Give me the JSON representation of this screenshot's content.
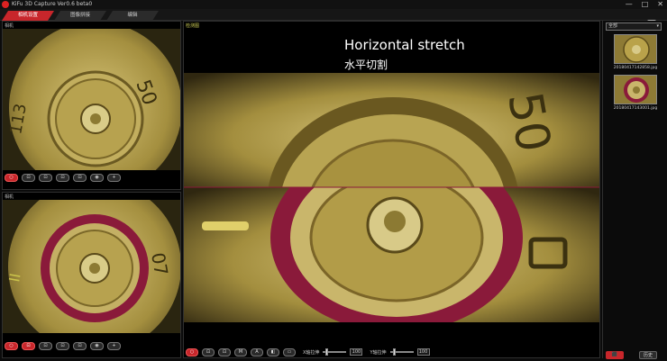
{
  "app": {
    "title": "KiFu 3D Capture Ver0.6 beta0",
    "window_buttons": [
      "—",
      "□",
      "✕"
    ]
  },
  "tabs": [
    {
      "label": "相机设置",
      "active": true
    },
    {
      "label": "图像拼接",
      "active": false
    },
    {
      "label": "编辑",
      "active": false
    }
  ],
  "left_top": {
    "label": "相机",
    "toolbar": [
      "○",
      "⊡",
      "⊡",
      "⊡",
      "⊡",
      "◉",
      "+"
    ]
  },
  "left_bottom": {
    "label": "相机",
    "toolbar": [
      "○",
      "⊡",
      "⊡",
      "⊡",
      "⊡",
      "◉",
      "+"
    ]
  },
  "center": {
    "label": "检测图",
    "overlay_en": "Horizontal stretch",
    "overlay_zh": "水平切割",
    "bottom_buttons": [
      "○",
      "⊡",
      "⊡",
      "M",
      "A",
      "◧",
      "▭"
    ],
    "slider1_label": "X轴拉伸",
    "slider1_value": "100",
    "slider2_label": "Y轴拉伸",
    "slider2_value": "100"
  },
  "right": {
    "select_value": "全部",
    "thumbs": [
      {
        "caption": "20180417142858.jpg"
      },
      {
        "caption": "20180417143001.jpg"
      }
    ],
    "btn_primary": "⬛",
    "btn_secondary": "历史"
  },
  "colors": {
    "accent": "#c8262b",
    "brass": "#b9a24a",
    "magenta_ring": "#8a1a3a"
  }
}
